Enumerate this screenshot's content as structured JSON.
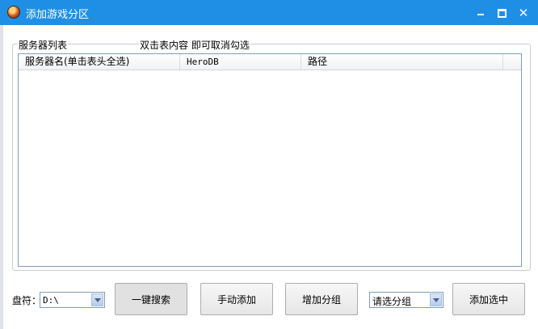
{
  "window": {
    "title": "添加游戏分区",
    "controls": [
      "minimize",
      "maximize",
      "close"
    ],
    "accent_color": "#1f8fe6"
  },
  "server_list": {
    "group_label": "服务器列表",
    "hint": "双击表内容 即可取消勾选",
    "columns": [
      "服务器名(单击表头全选)",
      "HeroDB",
      "路径",
      ""
    ],
    "rows": []
  },
  "drive": {
    "label": "盘符：",
    "value": "D:\\"
  },
  "buttons": {
    "search": "一键搜索",
    "manual_add": "手动添加",
    "add_group": "增加分组",
    "add_selected": "添加选中"
  },
  "group_select": {
    "value": "请选分组"
  }
}
